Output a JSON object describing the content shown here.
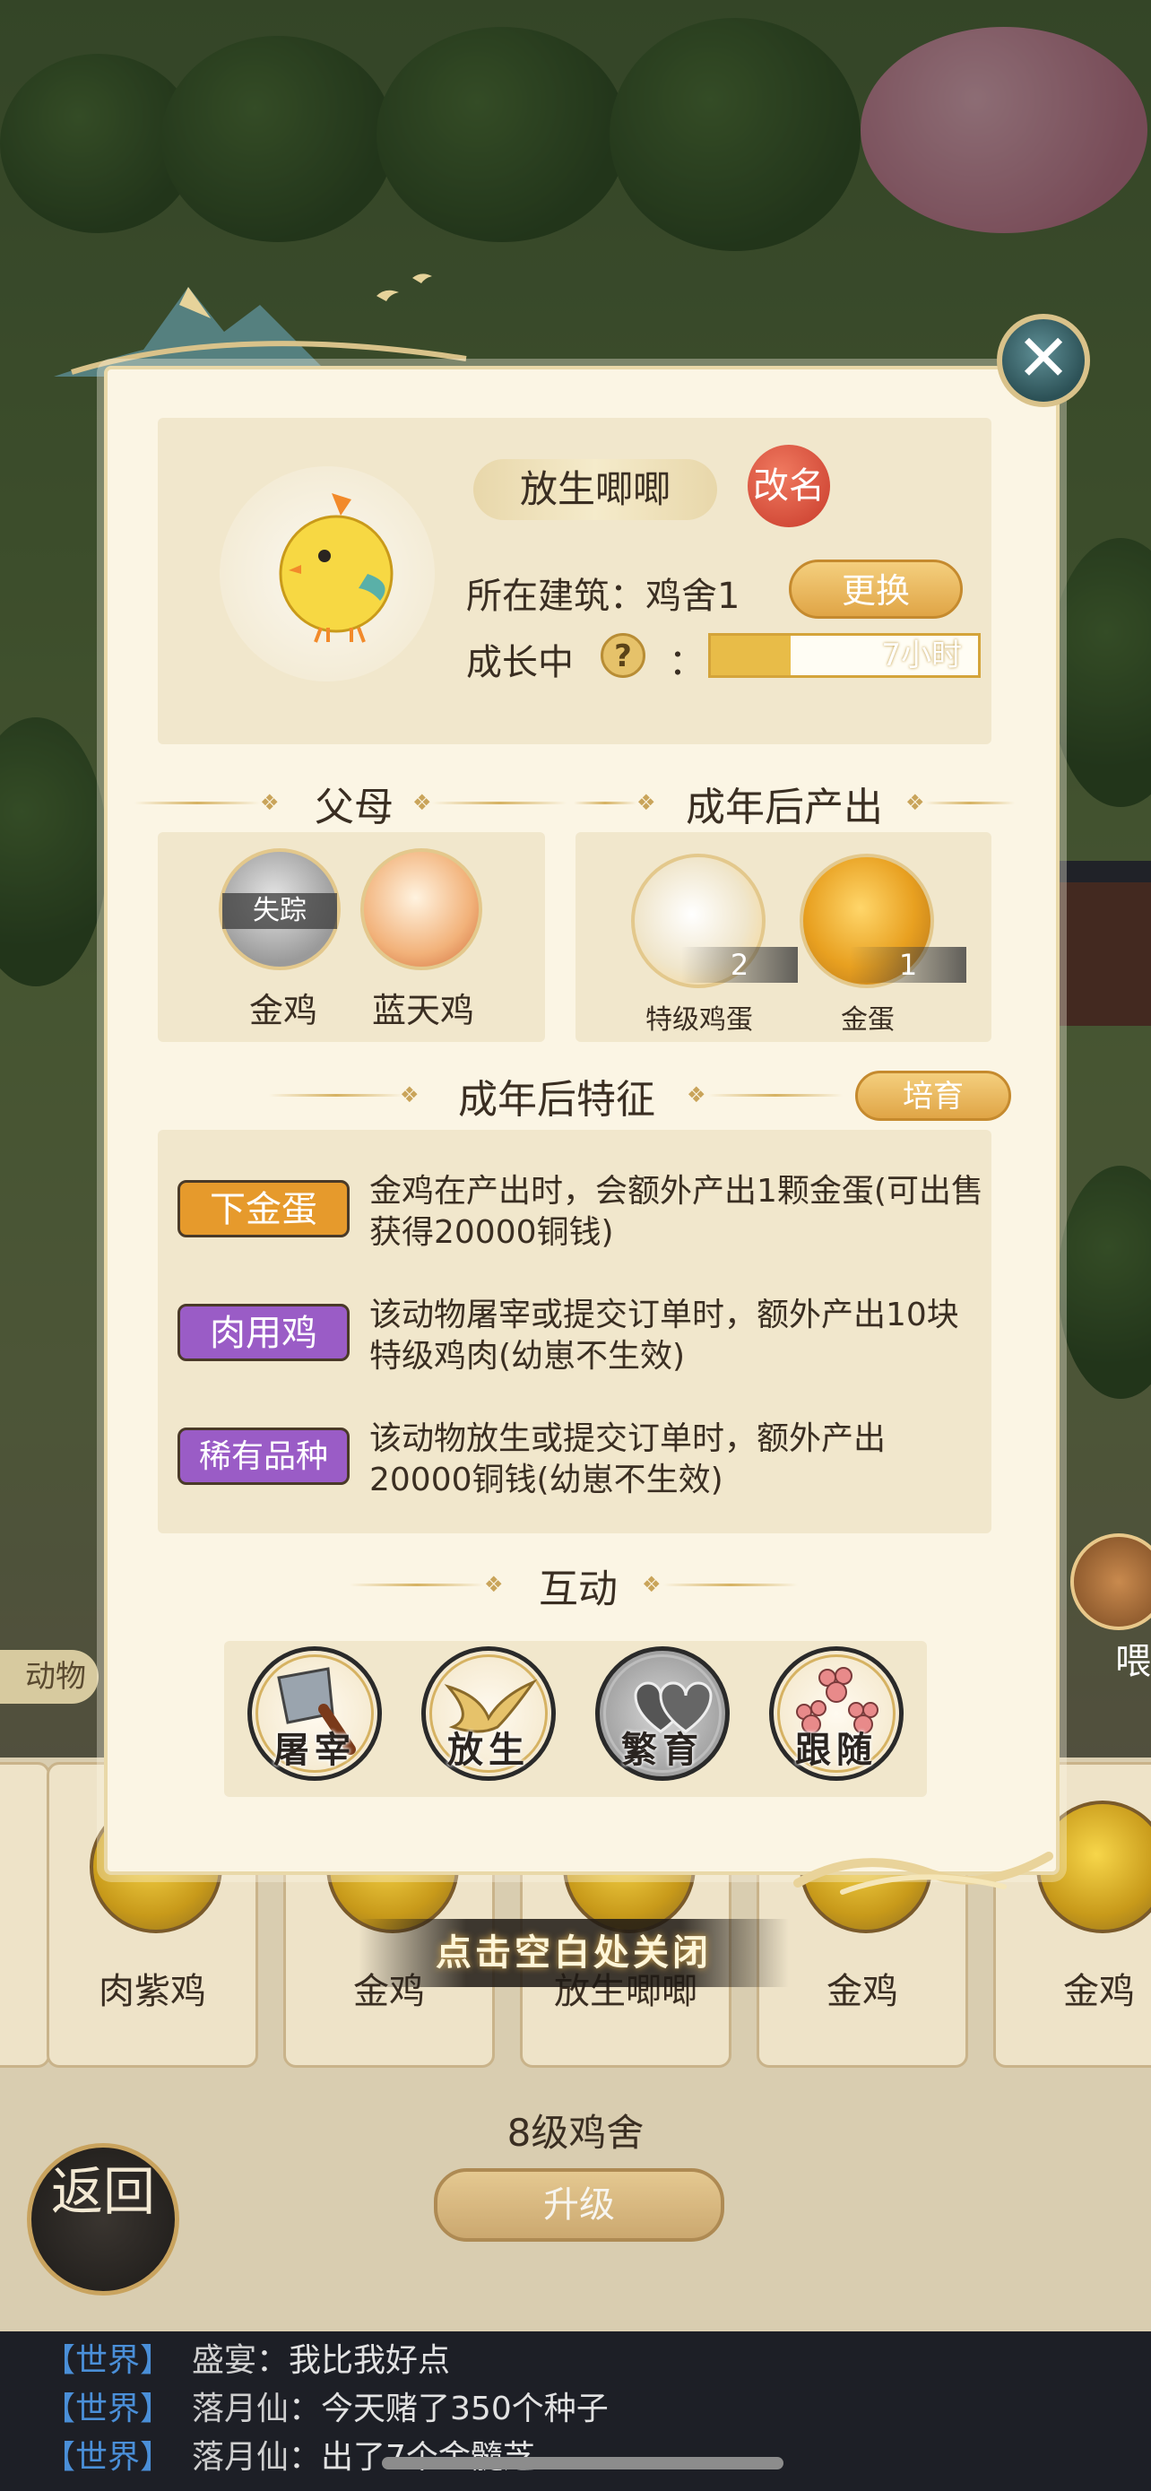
{
  "modal": {
    "close_icon": "close-x-icon",
    "pet_name": "放生唧唧",
    "rename_label": "改名",
    "location_label": "所在建筑：鸡舍1",
    "change_label": "更换",
    "growth_label": "成长中",
    "help_icon": "?",
    "colon": "：",
    "growth_progress": 0.3,
    "growth_time": "7小时",
    "parents": {
      "title": "父母",
      "items": [
        {
          "name": "金鸡",
          "status": "失踪"
        },
        {
          "name": "蓝天鸡"
        }
      ]
    },
    "outputs": {
      "title": "成年后产出",
      "items": [
        {
          "name": "特级鸡蛋",
          "count": "2"
        },
        {
          "name": "金蛋",
          "count": "1"
        }
      ]
    },
    "traits": {
      "title": "成年后特征",
      "breed_label": "培育",
      "items": [
        {
          "badge": "下金蛋",
          "color": "#e69a2c",
          "desc": "金鸡在产出时，会额外产出1颗金蛋(可出售获得20000铜钱)"
        },
        {
          "badge": "肉用鸡",
          "color": "#9a5cc6",
          "desc": "该动物屠宰或提交订单时，额外产出10块特级鸡肉(幼崽不生效)"
        },
        {
          "badge": "稀有品种",
          "color": "#9a5cc6",
          "desc": "该动物放生或提交订单时，额外产出20000铜钱(幼崽不生效)"
        }
      ]
    },
    "interact": {
      "title": "互动",
      "actions": [
        {
          "label": "屠宰",
          "icon": "cleaver-icon"
        },
        {
          "label": "放生",
          "icon": "bird-icon"
        },
        {
          "label": "繁育",
          "icon": "hearts-icon"
        },
        {
          "label": "跟随",
          "icon": "paw-icon"
        }
      ]
    }
  },
  "close_hint": "点击空白处关闭",
  "background": {
    "left_tab": "动物",
    "right_tab": "喂",
    "cards": [
      "肉紫鸡",
      "金鸡",
      "放生唧唧",
      "金鸡",
      "金鸡"
    ],
    "coop_title": "8级鸡舍",
    "upgrade_label": "升级",
    "back_label": "返回"
  },
  "chat": [
    {
      "tag": "【世界】",
      "name": "盛宴",
      "msg": "：我比我好点"
    },
    {
      "tag": "【世界】",
      "name": "落月仙",
      "msg": "：今天赌了350个种子"
    },
    {
      "tag": "【世界】",
      "name": "落月仙",
      "msg": "：出了7个金髓芝"
    }
  ]
}
